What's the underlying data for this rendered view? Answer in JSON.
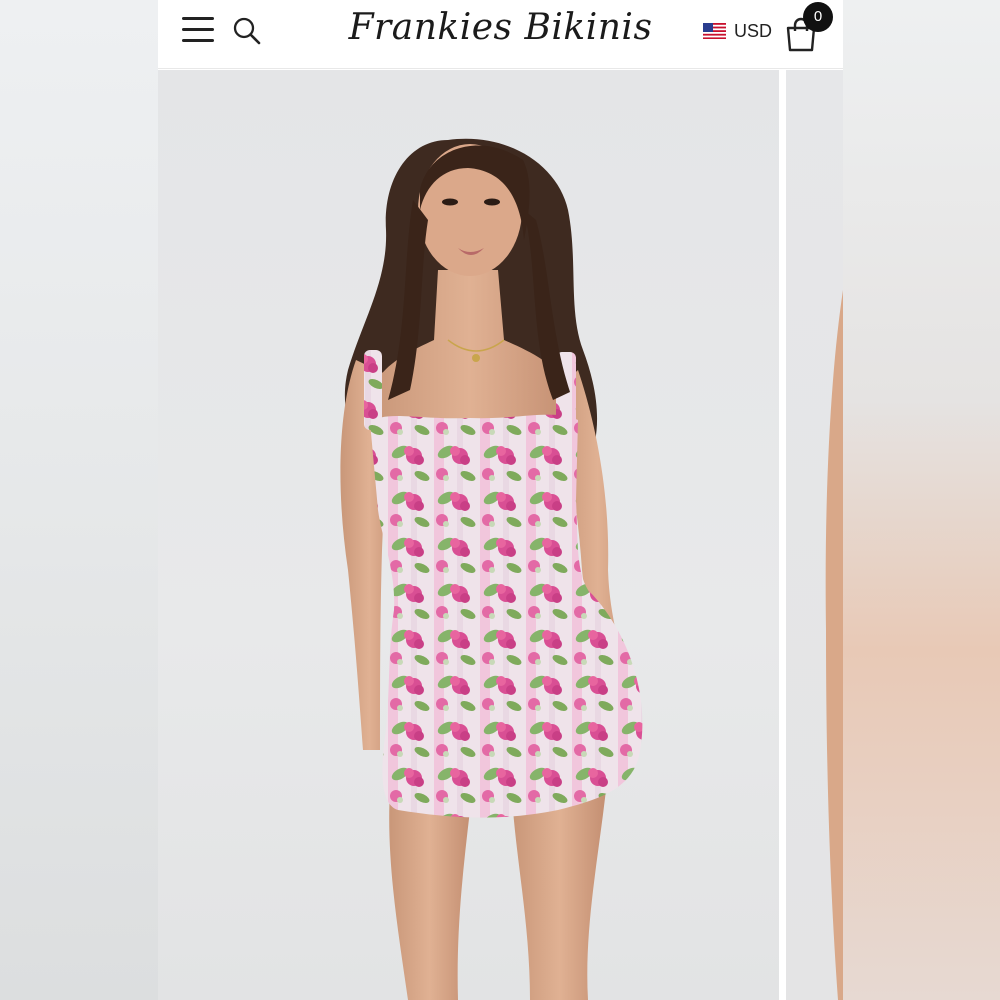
{
  "header": {
    "menu_icon": "hamburger-menu-icon",
    "search_icon": "search-icon",
    "logo_text": "Frankies Bikinis",
    "currency": {
      "flag_icon": "us-flag-icon",
      "label": "USD"
    },
    "cart": {
      "icon": "shopping-bag-icon",
      "count": "0"
    }
  },
  "gallery": {
    "main_image": "model-in-pink-floral-mini-dress",
    "next_image": "next-product-photo-preview"
  },
  "colors": {
    "header_bg": "#ffffff",
    "badge_bg": "#111111",
    "dress_pink": "#d94f94",
    "dress_leaf": "#7faa5c"
  }
}
